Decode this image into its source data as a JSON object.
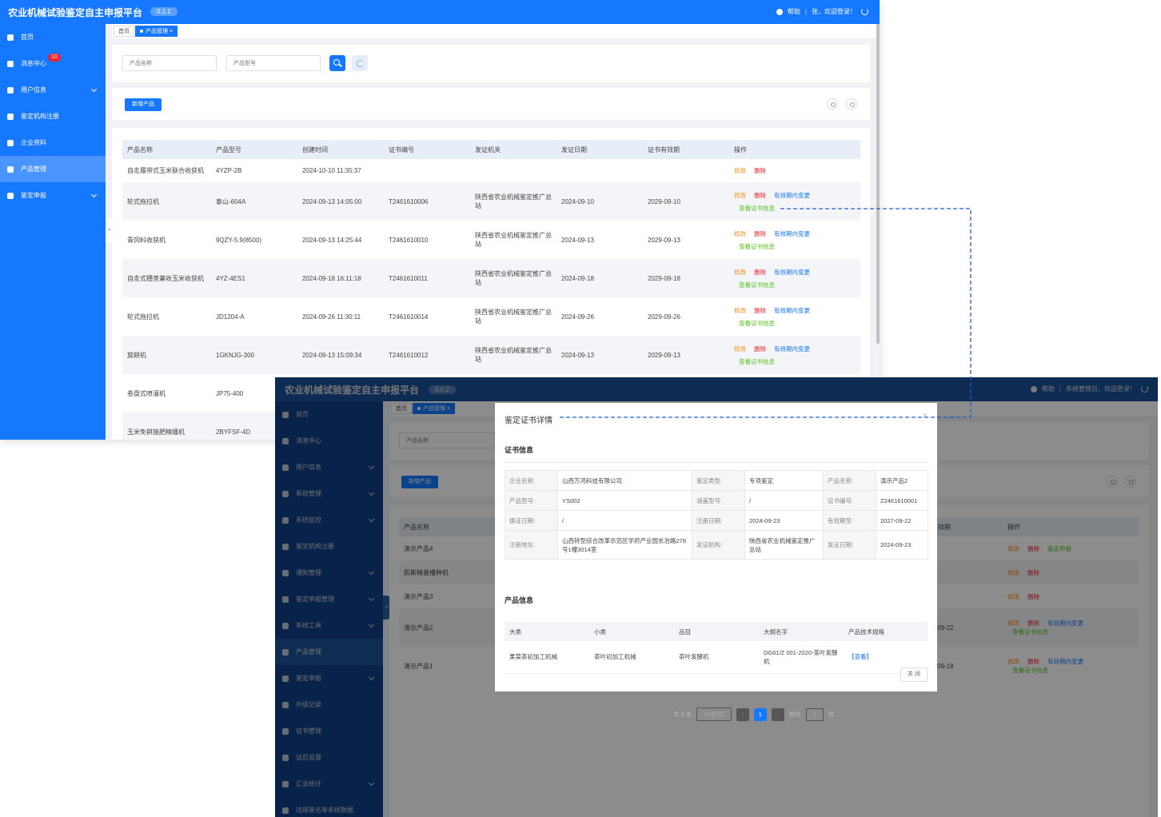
{
  "win1": {
    "title": "农业机械试验鉴定自主申报平台",
    "version": "0.1.1",
    "help": "帮助",
    "user": "张，欢迎登录！",
    "sidebar": [
      {
        "label": "首页"
      },
      {
        "label": "消息中心",
        "badge": "10"
      },
      {
        "label": "用户信息"
      },
      {
        "label": "鉴定机构注册"
      },
      {
        "label": "企业资料"
      },
      {
        "label": "产品管理"
      },
      {
        "label": "鉴定申报"
      }
    ],
    "tabs": [
      "首页",
      "产品管理"
    ],
    "search": {
      "name_placeholder": "产品名称",
      "model_placeholder": "产品型号"
    },
    "new_button": "新增产品",
    "columns": [
      "产品名称",
      "产品型号",
      "创建时间",
      "证书编号",
      "发证机关",
      "发证日期",
      "证书有效期",
      "操作"
    ],
    "actions": {
      "edit": "修改",
      "delete": "删除",
      "change": "有效期内变更",
      "view": "查看证书信息"
    },
    "rows": [
      {
        "name": "自走履带式玉米联合收获机",
        "model": "4YZP-2B",
        "created": "2024-10-10 11:35:37",
        "cert": "",
        "org": "",
        "issue": "",
        "expire": ""
      },
      {
        "name": "轮式拖拉机",
        "model": "泰山-604A",
        "created": "2024-09-13 14:05:00",
        "cert": "T2461610006",
        "org": "陕西省农业机械鉴定推广总站",
        "issue": "2024-09-10",
        "expire": "2029-09-10"
      },
      {
        "name": "青饲料收获机",
        "model": "9QZY-5.9(8500)",
        "created": "2024-09-13 14:25:44",
        "cert": "T2461610010",
        "org": "陕西省农业机械鉴定推广总站",
        "issue": "2024-09-13",
        "expire": "2029-09-13"
      },
      {
        "name": "自走式穗茎兼收玉米收获机",
        "model": "4YZ-4ES1",
        "created": "2024-09-18 16:11:18",
        "cert": "T2461610011",
        "org": "陕西省农业机械鉴定推广总站",
        "issue": "2024-09-18",
        "expire": "2029-09-18"
      },
      {
        "name": "轮式拖拉机",
        "model": "JD1204-A",
        "created": "2024-09-26 11:30:11",
        "cert": "T2461610014",
        "org": "陕西省农业机械鉴定推广总站",
        "issue": "2024-09-26",
        "expire": "2029-09-26"
      },
      {
        "name": "旋耕机",
        "model": "1GKNJG-300",
        "created": "2024-09-13 15:09:34",
        "cert": "T2461610012",
        "org": "陕西省农业机械鉴定推广总站",
        "issue": "2024-09-13",
        "expire": "2029-09-13"
      },
      {
        "name": "卷盘式喷灌机",
        "model": "JP75-400",
        "created": "",
        "cert": "",
        "org": "",
        "issue": "",
        "expire": ""
      },
      {
        "name": "玉米免耕施肥精播机",
        "model": "2BYFSF-4D",
        "created": "",
        "cert": "",
        "org": "",
        "issue": "",
        "expire": ""
      }
    ]
  },
  "win2": {
    "title": "农业机械试验鉴定自主申报平台",
    "version": "0.0.2",
    "help": "帮助",
    "user": "系统管理员，欢迎登录！",
    "sidebar": [
      {
        "label": "首页"
      },
      {
        "label": "消息中心"
      },
      {
        "label": "用户信息"
      },
      {
        "label": "系统管理"
      },
      {
        "label": "系统监控"
      },
      {
        "label": "鉴定机构注册"
      },
      {
        "label": "通知管理"
      },
      {
        "label": "鉴定申报管理"
      },
      {
        "label": "系统工具"
      },
      {
        "label": "产品管理"
      },
      {
        "label": "鉴定申报"
      },
      {
        "label": "升级记录"
      },
      {
        "label": "证书管理"
      },
      {
        "label": "证后监督"
      },
      {
        "label": "汇总统计"
      },
      {
        "label": "违规黑名单系统数据"
      }
    ],
    "tabs": [
      "首页",
      "产品管理"
    ],
    "search_placeholder": "产品名称",
    "new_button": "新增产品",
    "columns": {
      "name": "产品名称",
      "expire": "有效期",
      "ops": "操作"
    },
    "actions": {
      "edit": "修改",
      "delete": "删除",
      "declare": "鉴定申报",
      "change": "有效期内变更",
      "view": "查看证书信息"
    },
    "rows": [
      {
        "name": "演示产品4",
        "expire": ""
      },
      {
        "name": "肌斯精量播种机",
        "expire": ""
      },
      {
        "name": "演示产品3",
        "expire": ""
      },
      {
        "name": "演示产品2",
        "expire": "7-09-22"
      },
      {
        "name": "演示产品1",
        "expire": "9-09-18"
      }
    ],
    "pager": {
      "total": "共 5 条",
      "size": "10条/页",
      "page": "1",
      "goto": "前往",
      "goto_value": "1",
      "unit": "页"
    },
    "modal": {
      "title": "鉴定证书详情",
      "cert_section": "证书信息",
      "product_section": "产品信息",
      "cert": {
        "r1": [
          "企业名称:",
          "山西万鸿科技有限公司",
          "鉴定类型:",
          "专项鉴定",
          "产品名称:",
          "演示产品2"
        ],
        "r2": [
          "产品型号:",
          "YS002",
          "涵盖型号:",
          "/",
          "证书编号:",
          "Z2461610001"
        ],
        "r3": [
          "换证日期:",
          "/",
          "注册日期:",
          "2024-09-23",
          "有效期至:",
          "2027-09-22"
        ],
        "r4": [
          "注册地址:",
          "山西转型综合改革示范区学府产业园长治路278号1幢3014室",
          "发证机构:",
          "陕西省农业机械鉴定推广总站",
          "发证日期:",
          "2024-09-23"
        ]
      },
      "product_columns": [
        "大类",
        "小类",
        "品目",
        "大纲名字",
        "产品技术规格"
      ],
      "product_row": [
        "果菜茶初加工机械",
        "茶叶初加工机械",
        "茶叶发酵机",
        "DG61/Z 001-2020-茶叶发酵机",
        "【查看】"
      ],
      "close_button": "关 闭"
    }
  }
}
